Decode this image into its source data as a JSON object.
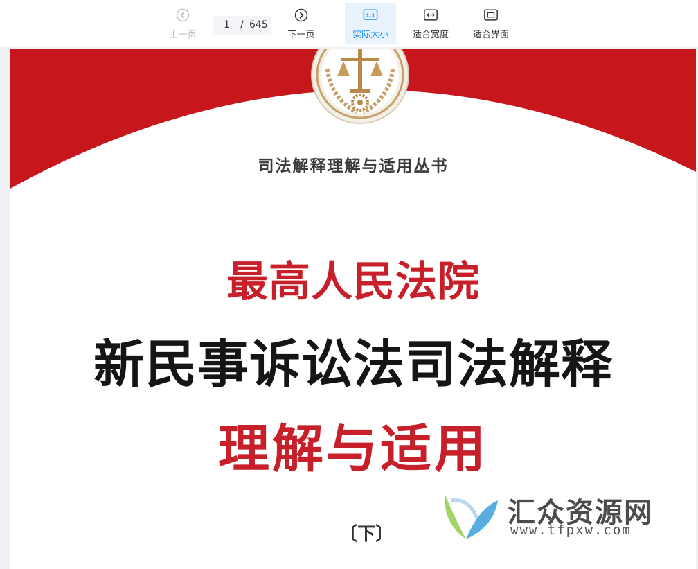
{
  "toolbar": {
    "prev_label": "上一页",
    "next_label": "下一页",
    "current_page": "1",
    "page_separator": "/",
    "total_pages": "645",
    "actual_size_label": "实际大小",
    "fit_width_label": "适合宽度",
    "fit_page_label": "适合界面",
    "actual_size_icon_text": "1:1",
    "active_mode": "actual_size",
    "accent_color": "#1a8cff"
  },
  "document": {
    "series_title": "司法解释理解与适用丛书",
    "title_line1": "最高人民法院",
    "title_line2": "新民事诉讼法司法解释",
    "title_line3": "理解与适用",
    "volume": "〔下〕",
    "emblem_icon": "scales-of-justice-emblem",
    "band_color": "#c8161d"
  },
  "watermark": {
    "site_name": "汇众资源网",
    "site_url": "www.tfpxw.com",
    "logo_icon": "leaf-v-logo-icon"
  }
}
